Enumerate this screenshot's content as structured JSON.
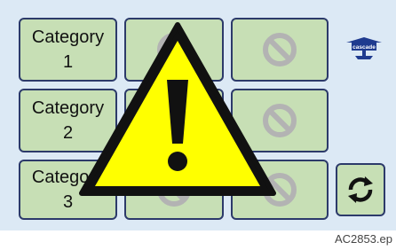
{
  "categories": [
    {
      "label_line1": "Category",
      "label_line2": "1"
    },
    {
      "label_line1": "Category",
      "label_line2": "2"
    },
    {
      "label_line1": "Category",
      "label_line2": "3"
    }
  ],
  "logo": {
    "text": "cascade",
    "icon": "cascade-logo"
  },
  "refresh": {
    "icon": "refresh-arrows-icon"
  },
  "warning": {
    "icon": "warning-triangle-icon",
    "fill": "#ffff00",
    "stroke": "#000000"
  },
  "disabled_icon": {
    "icon": "prohibited-circle-icon",
    "color": "#b3b3b3"
  },
  "colors": {
    "tile_bg": "#c7dfb5",
    "tile_border": "#2c3a6a",
    "screen_bg": "#dce9f5",
    "brand": "#1f3b8f"
  },
  "figure_code": "AC2853.ep"
}
